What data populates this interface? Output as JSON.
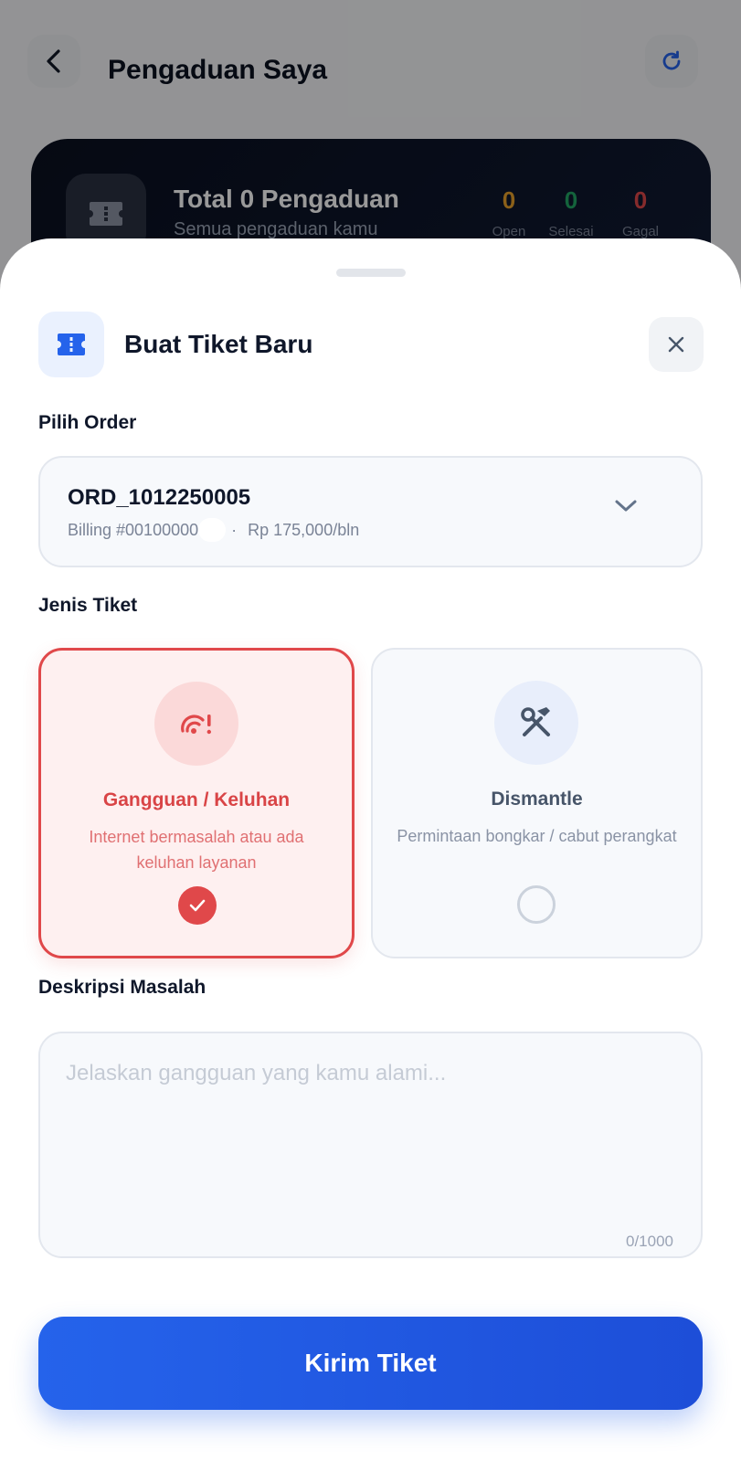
{
  "background": {
    "title": "Pengaduan Saya",
    "summary": {
      "title": "Total 0 Pengaduan",
      "subtitle": "Semua pengaduan kamu",
      "stats": [
        {
          "value": "0",
          "label": "Open",
          "color": "#e8a02a"
        },
        {
          "value": "0",
          "label": "Selesai",
          "color": "#22a565"
        },
        {
          "value": "0",
          "label": "Gagal",
          "color": "#e0484a"
        }
      ]
    }
  },
  "sheet": {
    "title": "Buat Tiket Baru",
    "order_label": "Pilih Order",
    "order": {
      "id": "ORD_1012250005",
      "billing": "Billing #00100000",
      "separator": "·",
      "price": "Rp 175,000/bln"
    },
    "type_label": "Jenis Tiket",
    "types": [
      {
        "name": "Gangguan / Keluhan",
        "desc": "Internet bermasalah atau ada keluhan layanan",
        "selected": true
      },
      {
        "name": "Dismantle",
        "desc": "Permintaan bongkar / cabut perangkat",
        "selected": false
      }
    ],
    "desc_label": "Deskripsi Masalah",
    "desc_placeholder": "Jelaskan gangguan yang kamu alami...",
    "desc_value": "",
    "counter": "0/1000",
    "submit_label": "Kirim Tiket"
  },
  "colors": {
    "accent": "#2563eb",
    "danger": "#e0484a"
  }
}
